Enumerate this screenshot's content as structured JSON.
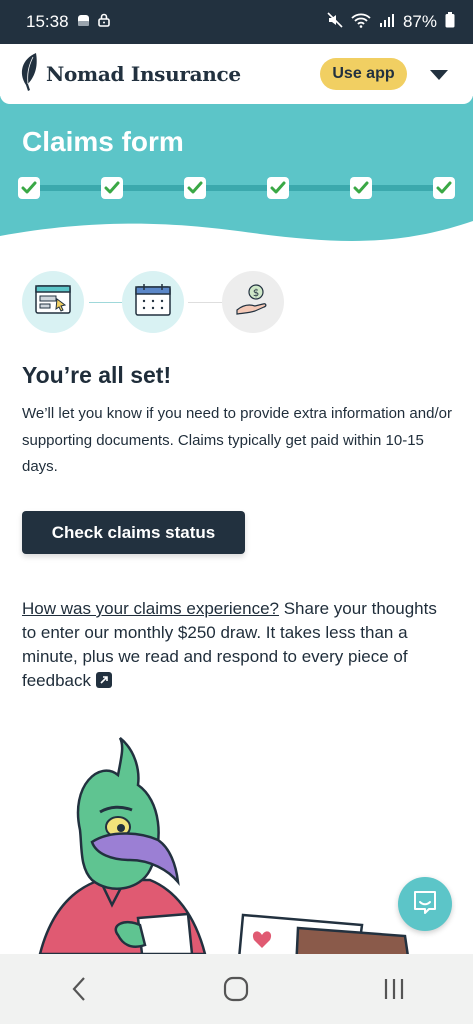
{
  "status_bar": {
    "time": "15:38",
    "battery": "87%",
    "icons": [
      "gallery-icon",
      "lock-icon",
      "mute-icon",
      "wifi-icon",
      "signal-icon",
      "battery-icon"
    ]
  },
  "header": {
    "brand": "Nomad Insurance",
    "use_app_label": "Use app",
    "menu_icon": "caret-down-icon"
  },
  "banner": {
    "title": "Claims form",
    "steps_completed": 6,
    "steps_total": 6,
    "bg_color": "#5cc5c8"
  },
  "steps": [
    {
      "icon": "browser-form-icon"
    },
    {
      "icon": "calendar-icon"
    },
    {
      "icon": "hand-coin-icon"
    }
  ],
  "main": {
    "title": "You’re all set!",
    "description": "We’ll let you know if you need to provide extra information and/or supporting documents. Claims typically get paid within 10-15 days.",
    "check_button": "Check claims status",
    "feedback_link": "How was your claims experience?",
    "feedback_text": " Share your thoughts to enter our monthly $250 draw. It takes less than a minute, plus we read and respond to every piece of feedback"
  },
  "chat": {
    "icon": "chat-icon"
  },
  "nav_bar": {
    "icons": [
      "back-icon",
      "home-icon",
      "recents-icon"
    ]
  }
}
